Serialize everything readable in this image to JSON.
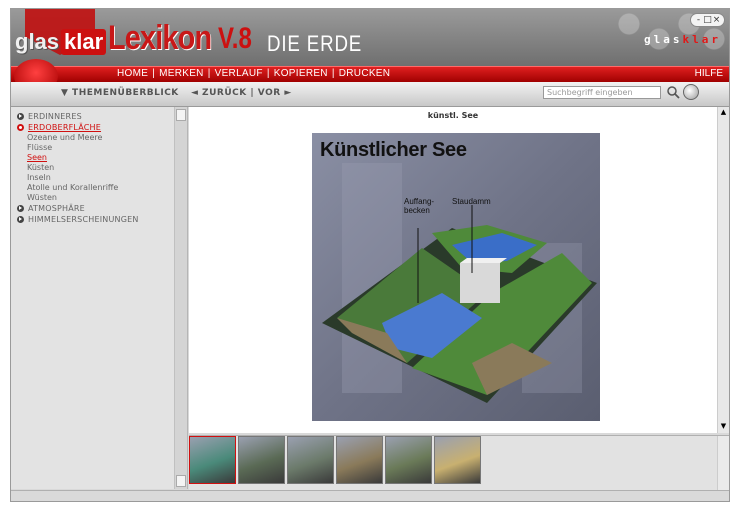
{
  "header": {
    "logo_part1": "glas",
    "logo_part2": "klar",
    "logo_part3": "Lexikon",
    "logo_version": "V.8",
    "title": "DIE ERDE",
    "brand_plain": "glas",
    "brand_accent": "klar",
    "window_buttons": [
      "-",
      "□",
      "×"
    ]
  },
  "menu": {
    "items": [
      "HOME",
      "MERKEN",
      "VERLAUF",
      "KOPIEREN",
      "DRUCKEN"
    ],
    "help": "HILFE"
  },
  "navbar": {
    "topics": "▼ THEMENÜBERBLICK",
    "back": "◄ ZURÜCK",
    "separator": "|",
    "forward": "VOR ►",
    "search_placeholder": "Suchbegriff eingeben"
  },
  "sidebar": {
    "sections": [
      {
        "label": "ERDINNERES",
        "active": false
      },
      {
        "label": "ERDOBERFLÄCHE",
        "active": true
      },
      {
        "label": "ATMOSPHÄRE",
        "active": false
      },
      {
        "label": "HIMMELSERSCHEINUNGEN",
        "active": false
      }
    ],
    "subitems": [
      "Ozeane und Meere",
      "Flüsse",
      "Seen",
      "Küsten",
      "Inseln",
      "Atolle und Korallenriffe",
      "Wüsten"
    ],
    "selected_subitem": "Seen"
  },
  "main": {
    "caption": "künstl. See",
    "image_title": "Künstlicher See",
    "label_basin": "Auffang-\nbecken",
    "label_dam": "Staudamm"
  },
  "thumbnails": {
    "count": 6,
    "colors": [
      "#4a8a7a",
      "#5a6a55",
      "#6b7a6a",
      "#8a7a5a",
      "#6a7a58",
      "#c8b070"
    ]
  },
  "colors": {
    "accent_red": "#cc1010",
    "header_gray": "#8a8a8a"
  }
}
